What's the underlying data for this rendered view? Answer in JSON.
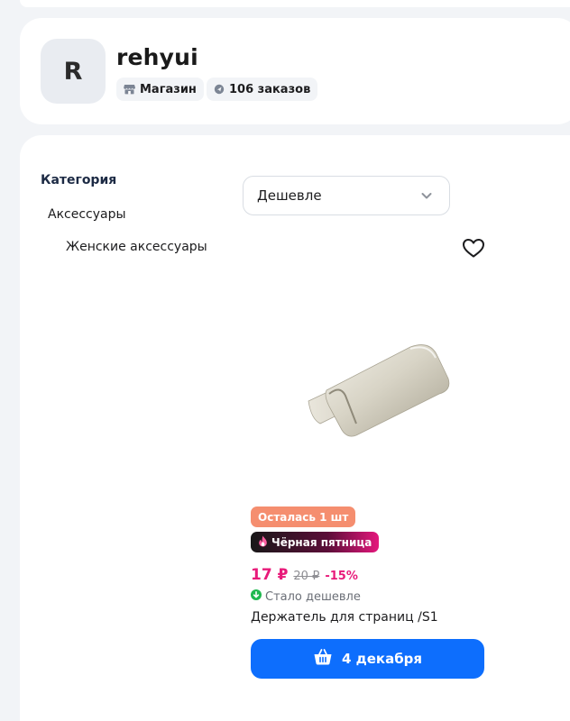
{
  "shop": {
    "avatar_letter": "R",
    "name": "rehyui",
    "type_label": "Магазин",
    "orders_label": "106 заказов"
  },
  "filters": {
    "category_title": "Категория",
    "category": "Аксессуары",
    "subcategory": "Женские аксессуары"
  },
  "sort": {
    "selected": "Дешевле"
  },
  "product": {
    "badge_stock": "Осталась 1 шт",
    "badge_promo": "Чёрная пятница",
    "price_now": "17 ₽",
    "price_old": "20 ₽",
    "discount": "-15%",
    "price_note": "Стало дешевле",
    "name": "Держатель для страниц /S1",
    "cart_button": "4 декабря"
  },
  "colors": {
    "accent_blue": "#0d6efd",
    "price_pink": "#e81a7a",
    "stock_badge": "#f58e6f",
    "page_bg": "#f2f4f7"
  },
  "icons": [
    "store-icon",
    "orders-icon",
    "chevron-down-icon",
    "heart-icon",
    "fire-icon",
    "arrow-down-circle-icon",
    "basket-icon"
  ]
}
